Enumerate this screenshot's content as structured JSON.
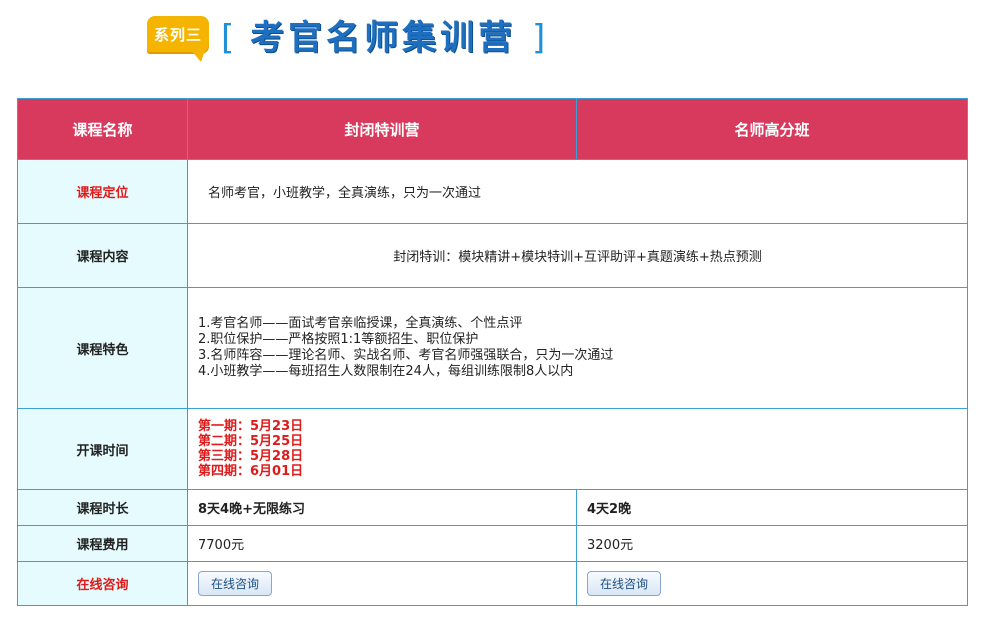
{
  "header": {
    "badge": "系列三",
    "bracket_left": "[",
    "title": "考官名师集训营",
    "bracket_right": "]"
  },
  "table": {
    "columns": [
      "课程名称",
      "封闭特训营",
      "名师高分班"
    ],
    "rows": {
      "positioning": {
        "label": "课程定位",
        "value": "名师考官，小班教学，全真演练，只为一次通过"
      },
      "content": {
        "label": "课程内容",
        "value": "封闭特训：模块精讲+模块特训+互评助评+真题演练+热点预测"
      },
      "features": {
        "label": "课程特色",
        "lines": [
          "1.考官名师——面试考官亲临授课，全真演练、个性点评",
          "2.职位保护——严格按照1:1等额招生、职位保护",
          "3.名师阵容——理论名师、实战名师、考官名师强强联合，只为一次通过",
          "4.小班教学——每班招生人数限制在24人，每组训练限制8人以内"
        ]
      },
      "schedule": {
        "label": "开课时间",
        "lines": [
          "第一期：5月23日",
          "第二期：5月25日",
          "第三期：5月28日",
          "第四期：6月01日"
        ]
      },
      "duration": {
        "label": "课程时长",
        "col1": "8天4晚+无限练习",
        "col2": "4天2晚"
      },
      "fee": {
        "label": "课程费用",
        "col1": "7700元",
        "col2": "3200元"
      },
      "consult": {
        "label": "在线咨询",
        "button1": "在线咨询",
        "button2": "在线咨询"
      }
    }
  },
  "colors": {
    "header_row": "#d83a5e",
    "label_bg": "#e6fbfd",
    "border": "#3ba0d6",
    "highlight_red": "#e01a1a",
    "title_blue": "#1e6fc0",
    "badge": "#f4b400"
  }
}
